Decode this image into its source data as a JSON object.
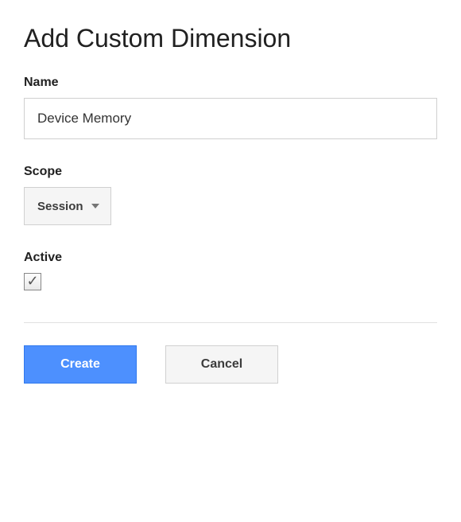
{
  "title": "Add Custom Dimension",
  "fields": {
    "name": {
      "label": "Name",
      "value": "Device Memory"
    },
    "scope": {
      "label": "Scope",
      "selected": "Session"
    },
    "active": {
      "label": "Active",
      "checked": true
    }
  },
  "buttons": {
    "create": "Create",
    "cancel": "Cancel"
  }
}
